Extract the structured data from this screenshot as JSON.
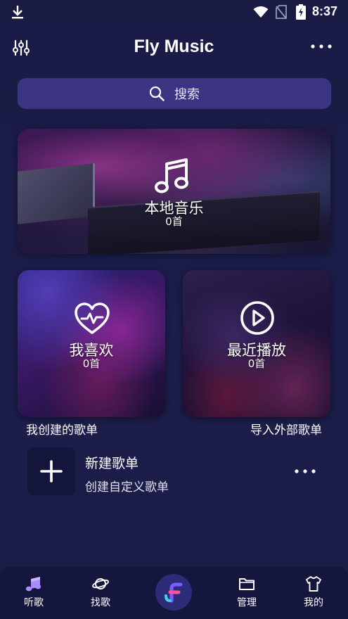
{
  "status_bar": {
    "time": "8:37",
    "icons": [
      "download-icon",
      "wifi-icon",
      "no-sim-icon",
      "battery-charging-icon"
    ]
  },
  "header": {
    "title": "Fly Music",
    "left_icon": "equalizer-icon",
    "right_icon": "more-icon"
  },
  "search": {
    "placeholder": "搜索",
    "icon": "search-icon"
  },
  "cards": {
    "local": {
      "label": "本地音乐",
      "count": "0首",
      "icon": "music-note-icon"
    },
    "favorites": {
      "label": "我喜欢",
      "count": "0首",
      "icon": "heart-pulse-icon"
    },
    "recent": {
      "label": "最近播放",
      "count": "0首",
      "icon": "play-circle-icon"
    }
  },
  "sections": {
    "my_playlists": "我创建的歌单",
    "import_playlists": "导入外部歌单"
  },
  "new_playlist": {
    "title": "新建歌单",
    "subtitle": "创建自定义歌单",
    "icon": "plus-icon"
  },
  "bottom_nav": {
    "items": [
      {
        "label": "听歌",
        "icon": "music-note-icon",
        "active": true
      },
      {
        "label": "找歌",
        "icon": "planet-icon",
        "active": false
      },
      {
        "label": "",
        "icon": "app-logo-icon",
        "active": false
      },
      {
        "label": "管理",
        "icon": "folder-icon",
        "active": false
      },
      {
        "label": "我的",
        "icon": "shirt-icon",
        "active": false
      }
    ]
  },
  "colors": {
    "background": "#1b1c47",
    "search_bg": "#3a3482",
    "nav_bg": "#15163d",
    "active_nav_icon": "#a98cff"
  }
}
